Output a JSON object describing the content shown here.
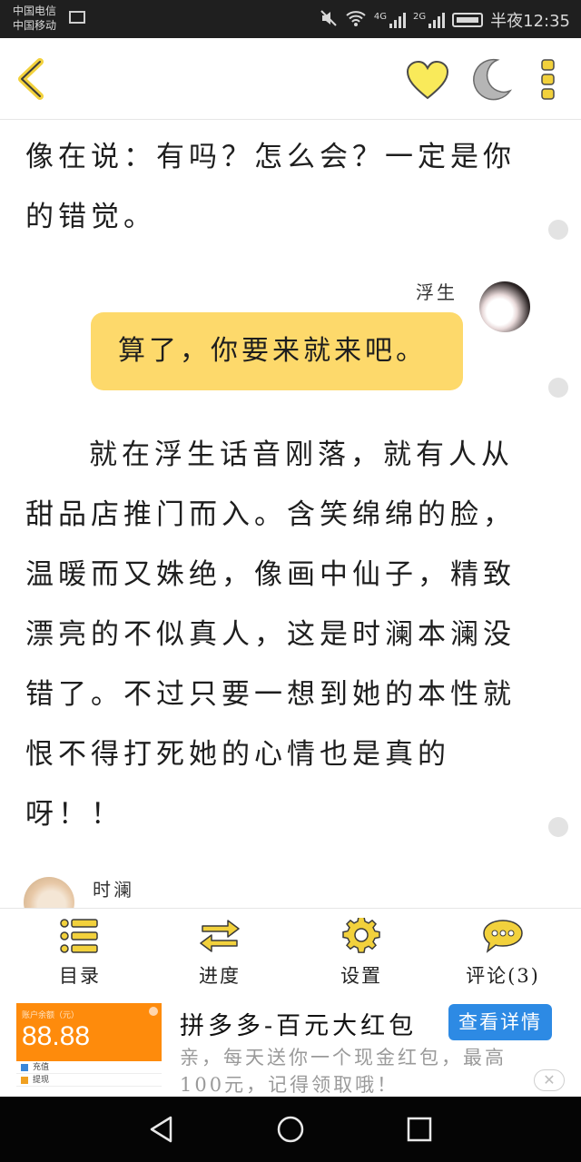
{
  "status_bar": {
    "carrier_1": "中国电信",
    "carrier_2": "中国移动",
    "network_1": "4G",
    "network_2": "2G",
    "time": "半夜12:35"
  },
  "top_bar": {
    "back_icon": "chevron-left-icon",
    "favorite_icon": "heart-icon",
    "night_mode_icon": "moon-icon",
    "more_icon": "vertical-dots-icon",
    "accent_color": "#f6d54a"
  },
  "content": {
    "paragraph_1": "像在说：有吗？怎么会？一定是你的错觉。",
    "bubble_speaker": "浮生",
    "bubble_text": "算了，你要来就来吧。",
    "bubble_color": "#fdd96b",
    "paragraph_2": "就在浮生话音刚落，就有人从甜品店推门而入。含笑绵绵的脸，温暖而又姝绝，像画中仙子，精致漂亮的不似真人，这是时澜本澜没错了。不过只要一想到她的本性就恨不得打死她的心情也是真的呀！！",
    "next_speaker": "时澜"
  },
  "bottom_nav": {
    "items": [
      {
        "label": "目录",
        "icon": "list-icon"
      },
      {
        "label": "进度",
        "icon": "swap-arrows-icon"
      },
      {
        "label": "设置",
        "icon": "gear-icon"
      },
      {
        "label": "评论(3)",
        "icon": "chat-bubble-icon"
      }
    ],
    "icon_color": "#f2d13c"
  },
  "ad": {
    "thumb_label": "账户余额（元）",
    "thumb_amount": "88.88",
    "thumb_row_1": "充值",
    "thumb_row_2": "提现",
    "title": "拼多多-百元大红包",
    "cta": "查看详情",
    "description": "亲，每天送你一个现金红包，最高100元，记得领取哦！",
    "cta_color": "#2d8ae4"
  },
  "system_nav": {
    "back_icon": "triangle-back-icon",
    "home_icon": "circle-home-icon",
    "recents_icon": "square-recents-icon"
  }
}
